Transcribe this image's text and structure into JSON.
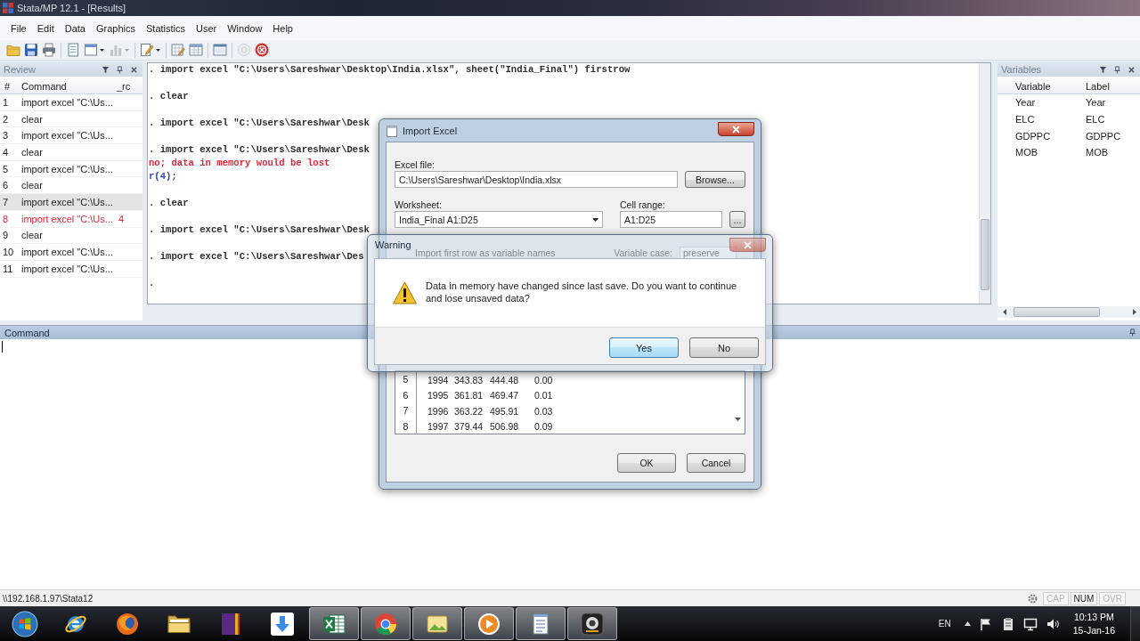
{
  "window": {
    "title": "Stata/MP 12.1 - [Results]"
  },
  "menu": [
    "File",
    "Edit",
    "Data",
    "Graphics",
    "Statistics",
    "User",
    "Window",
    "Help"
  ],
  "toolbar": [
    {
      "kind": "plain",
      "disabled": false
    },
    {
      "kind": "plain",
      "disabled": false
    },
    {
      "kind": "plain",
      "disabled": false
    },
    {
      "kind": "plain",
      "disabled": false
    },
    {
      "kind": "split",
      "disabled": false
    },
    {
      "kind": "split",
      "disabled": true
    },
    {
      "kind": "split",
      "disabled": false
    },
    {
      "kind": "plain",
      "disabled": false
    },
    {
      "kind": "plain",
      "disabled": false
    },
    {
      "kind": "plain",
      "disabled": false
    },
    {
      "kind": "plain",
      "disabled": true
    },
    {
      "kind": "plain",
      "disabled": false
    }
  ],
  "review": {
    "title": "Review",
    "columns": [
      "#",
      "Command",
      "_rc"
    ],
    "rows": [
      {
        "num": "1",
        "command": "import excel \"C:\\Us...",
        "error": false,
        "selected": false
      },
      {
        "num": "2",
        "command": "clear",
        "error": false,
        "selected": false
      },
      {
        "num": "3",
        "command": "import excel \"C:\\Us...",
        "error": false,
        "selected": false
      },
      {
        "num": "4",
        "command": "clear",
        "error": false,
        "selected": false
      },
      {
        "num": "5",
        "command": "import excel \"C:\\Us...",
        "error": false,
        "selected": false
      },
      {
        "num": "6",
        "command": "clear",
        "error": false,
        "selected": false
      },
      {
        "num": "7",
        "command": "import excel \"C:\\Us...",
        "error": false,
        "selected": true
      },
      {
        "num": "8",
        "command": "import excel \"C:\\Us...",
        "rc": "4",
        "error": true,
        "selected": false
      },
      {
        "num": "9",
        "command": "clear",
        "error": false,
        "selected": false
      },
      {
        "num": "10",
        "command": "import excel \"C:\\Us...",
        "error": false,
        "selected": false
      },
      {
        "num": "11",
        "command": "import excel \"C:\\Us...",
        "error": false,
        "selected": false
      }
    ]
  },
  "results": {
    "lines": [
      {
        "kind": "command",
        "text": ". import excel \"C:\\Users\\Sareshwar\\Desktop\\India.xlsx\", sheet(\"India_Final\") firstrow"
      },
      {
        "kind": "command",
        "text": ". clear"
      },
      {
        "kind": "command",
        "text": ". import excel \"C:\\Users\\Sareshwar\\Desk"
      },
      {
        "kind": "command",
        "text": ". import excel \"C:\\Users\\Sareshwar\\Desk"
      },
      {
        "kind": "error",
        "text": "no; data in memory would be lost"
      },
      {
        "kind": "return_code",
        "text": "r(4);"
      },
      {
        "kind": "command",
        "text": ". clear"
      },
      {
        "kind": "command",
        "text": ". import excel \"C:\\Users\\Sareshwar\\Desk"
      },
      {
        "kind": "command",
        "text": ". import excel \"C:\\Users\\Sareshwar\\Des"
      },
      {
        "kind": "prompt",
        "text": "."
      }
    ]
  },
  "variables": {
    "title": "Variables",
    "columns": [
      "Variable",
      "Label"
    ],
    "rows": [
      {
        "name": "Year",
        "label": "Year"
      },
      {
        "name": "ELC",
        "label": "ELC"
      },
      {
        "name": "GDPPC",
        "label": "GDPPC"
      },
      {
        "name": "MOB",
        "label": "MOB"
      }
    ]
  },
  "command": {
    "title": "Command"
  },
  "status_bar": {
    "path": "\\\\192.168.1.97\\Stata12",
    "indicators": [
      {
        "label": "CAP",
        "on": false
      },
      {
        "label": "NUM",
        "on": true
      },
      {
        "label": "OVR",
        "on": false
      }
    ]
  },
  "import_dialog": {
    "title": "Import Excel",
    "file_label": "Excel file:",
    "file_value": "C:\\Users\\Sareshwar\\Desktop\\India.xlsx",
    "browse_button": "Browse...",
    "worksheet_label": "Worksheet:",
    "worksheet_value": "India_Final A1:D25",
    "cell_range_label": "Cell range:",
    "cell_range_value": "A1:D25",
    "range_button": "...",
    "first_row_label": "Import first row as variable names",
    "variable_case_label": "Variable case:",
    "variable_case_value": "preserve",
    "preview_rows": [
      [
        "5",
        "1994",
        "343.83",
        "444.48",
        "0.00"
      ],
      [
        "6",
        "1995",
        "361.81",
        "469.47",
        "0.01"
      ],
      [
        "7",
        "1996",
        "363.22",
        "495.91",
        "0.03"
      ],
      [
        "8",
        "1997",
        "379.44",
        "506.98",
        "0.09"
      ]
    ],
    "buttons": [
      "OK",
      "Cancel"
    ]
  },
  "warning_dialog": {
    "title": "Warning",
    "message": "Data in memory have changed since last save. Do you want to continue and lose unsaved data?",
    "buttons": [
      {
        "label": "Yes",
        "focused": true
      },
      {
        "label": "No",
        "focused": false
      }
    ]
  },
  "taskbar": {
    "apps": [
      {
        "running": false
      },
      {
        "running": false
      },
      {
        "running": false
      },
      {
        "running": false
      },
      {
        "running": false
      },
      {
        "running": true
      },
      {
        "running": true
      },
      {
        "running": true
      },
      {
        "running": true
      },
      {
        "running": true
      },
      {
        "running": true
      }
    ],
    "language": "EN",
    "time": "10:13 PM",
    "date": "15-Jan-16"
  }
}
